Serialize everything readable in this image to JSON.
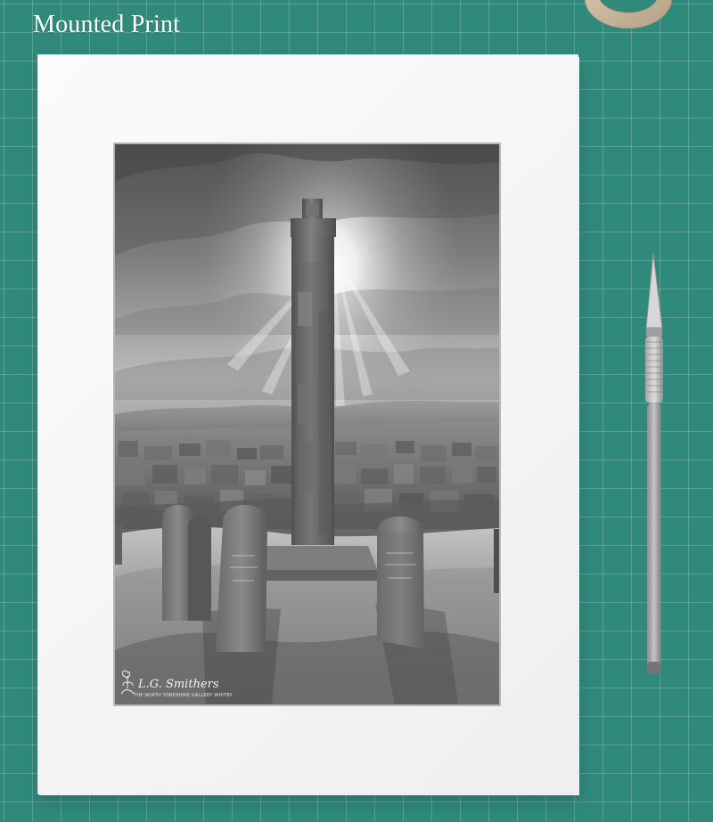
{
  "header": {
    "title": "Mounted Print"
  },
  "photo": {
    "signature": {
      "name": "L.G. Smithers",
      "tagline": "THE NORTH YORKSHIRE GALLERY WHITBY"
    }
  },
  "icons": {
    "tape_roll": "tape-roll-icon",
    "craft_knife": "craft-knife-icon",
    "signature_logo": "signature-logo-icon"
  },
  "colors": {
    "mat": "#f6f6f6",
    "cutting_mat": "#2f8a7b"
  }
}
